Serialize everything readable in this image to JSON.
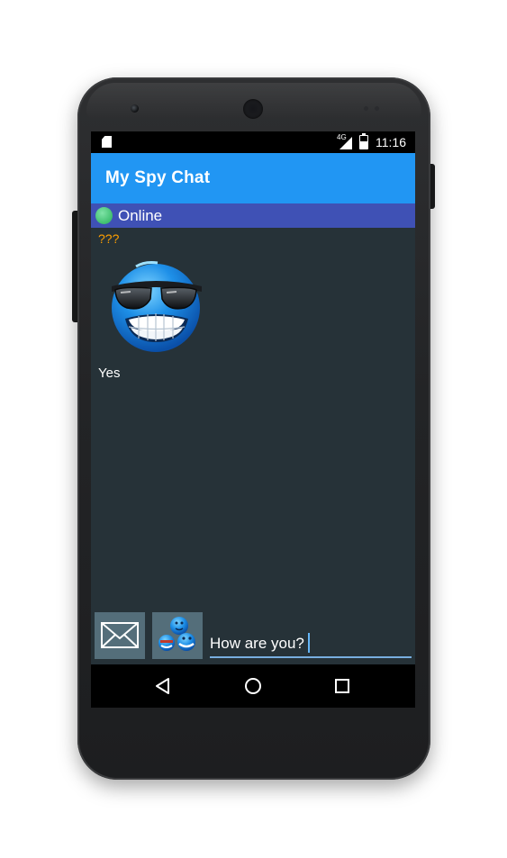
{
  "status_bar": {
    "time": "11:16",
    "network": "4G",
    "icons": [
      "sd-card-icon",
      "signal-icon",
      "battery-charging-icon"
    ]
  },
  "app_bar": {
    "title": "My Spy Chat",
    "color": "#2196f3"
  },
  "presence": {
    "label": "Online",
    "dot_color": "#3fbf6f",
    "bar_color": "#3f51b5"
  },
  "messages": [
    {
      "sender": "???",
      "sticker": "cool-sunglasses-smiley-icon",
      "text": "Yes"
    }
  ],
  "composer": {
    "send_icon": "envelope-icon",
    "sticker_icon": "stickers-icon",
    "input_value": "How are you?"
  },
  "navigation": {
    "icons": [
      "back-icon",
      "home-icon",
      "recents-icon"
    ]
  },
  "colors": {
    "background": "#263238",
    "sender_name": "#ffa000",
    "composer_button": "#546e7a",
    "input_underline": "#78aee0"
  }
}
